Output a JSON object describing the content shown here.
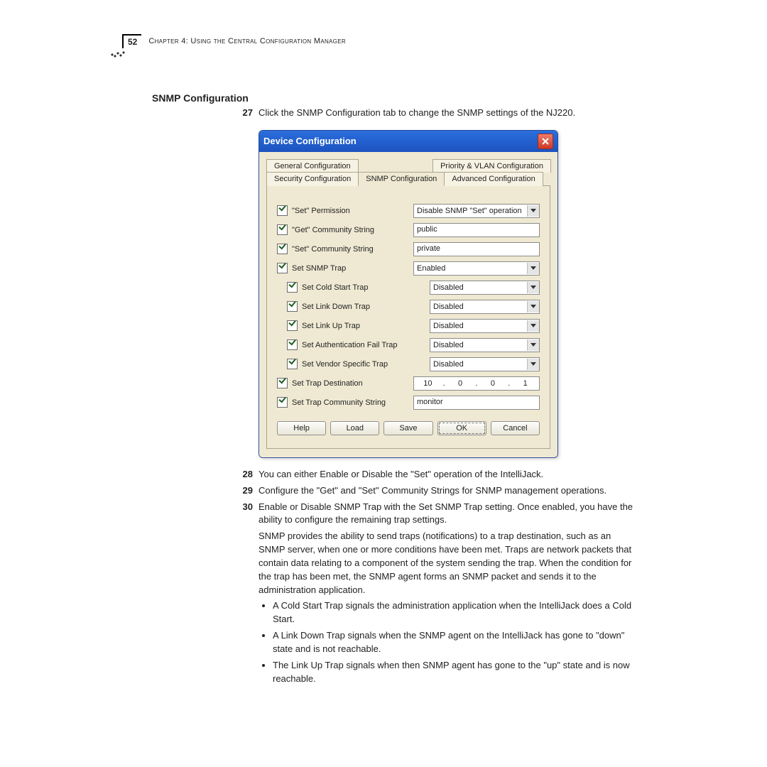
{
  "page_number": "52",
  "chapter_title": "Chapter 4: Using the Central Configuration Manager",
  "section_title": "SNMP Configuration",
  "steps": {
    "27": "Click the SNMP Configuration tab to change the SNMP settings of the NJ220.",
    "28": "You can either Enable or Disable the \"Set\" operation of the IntelliJack.",
    "29": "Configure the \"Get\" and \"Set\" Community Strings for SNMP management operations.",
    "30": "Enable or Disable SNMP Trap with the Set SNMP Trap setting. Once enabled, you have the ability to configure the remaining trap settings."
  },
  "para1": "SNMP provides the ability to send traps (notifications) to a trap destination, such as an SNMP server, when one or more conditions have been met. Traps are network packets that contain data relating to a component of the system sending the trap. When the condition for the trap has been met, the SNMP agent forms an SNMP packet and sends it to the administration application.",
  "bullets": [
    "A Cold Start Trap signals the administration application when the IntelliJack does a Cold Start.",
    "A Link Down Trap signals when the SNMP agent on the IntelliJack has gone to \"down\" state and is not reachable.",
    "The Link Up Trap signals when then SNMP agent has gone to the \"up\" state and is now reachable."
  ],
  "dialog": {
    "title": "Device Configuration",
    "tabs": {
      "general": "General Configuration",
      "priority": "Priority & VLAN Configuration",
      "security": "Security Configuration",
      "snmp": "SNMP Configuration",
      "advanced": "Advanced Configuration"
    },
    "rows": {
      "set_perm_label": "\"Set\" Permission",
      "set_perm_value": "Disable SNMP \"Set\" operation",
      "get_comm_label": "\"Get\" Community String",
      "get_comm_value": "public",
      "set_comm_label": "\"Set\" Community String",
      "set_comm_value": "private",
      "snmp_trap_label": "Set SNMP Trap",
      "snmp_trap_value": "Enabled",
      "cold_start_label": "Set Cold Start Trap",
      "cold_start_value": "Disabled",
      "link_down_label": "Set Link Down Trap",
      "link_down_value": "Disabled",
      "link_up_label": "Set Link Up Trap",
      "link_up_value": "Disabled",
      "auth_fail_label": "Set Authentication Fail Trap",
      "auth_fail_value": "Disabled",
      "vendor_label": "Set Vendor Specific Trap",
      "vendor_value": "Disabled",
      "trap_dest_label": "Set Trap Destination",
      "trap_dest_ip": {
        "a": "10",
        "b": "0",
        "c": "0",
        "d": "1"
      },
      "trap_comm_label": "Set Trap Community String",
      "trap_comm_value": "monitor"
    },
    "buttons": {
      "help": "Help",
      "load": "Load",
      "save": "Save",
      "ok": "OK",
      "cancel": "Cancel"
    }
  }
}
